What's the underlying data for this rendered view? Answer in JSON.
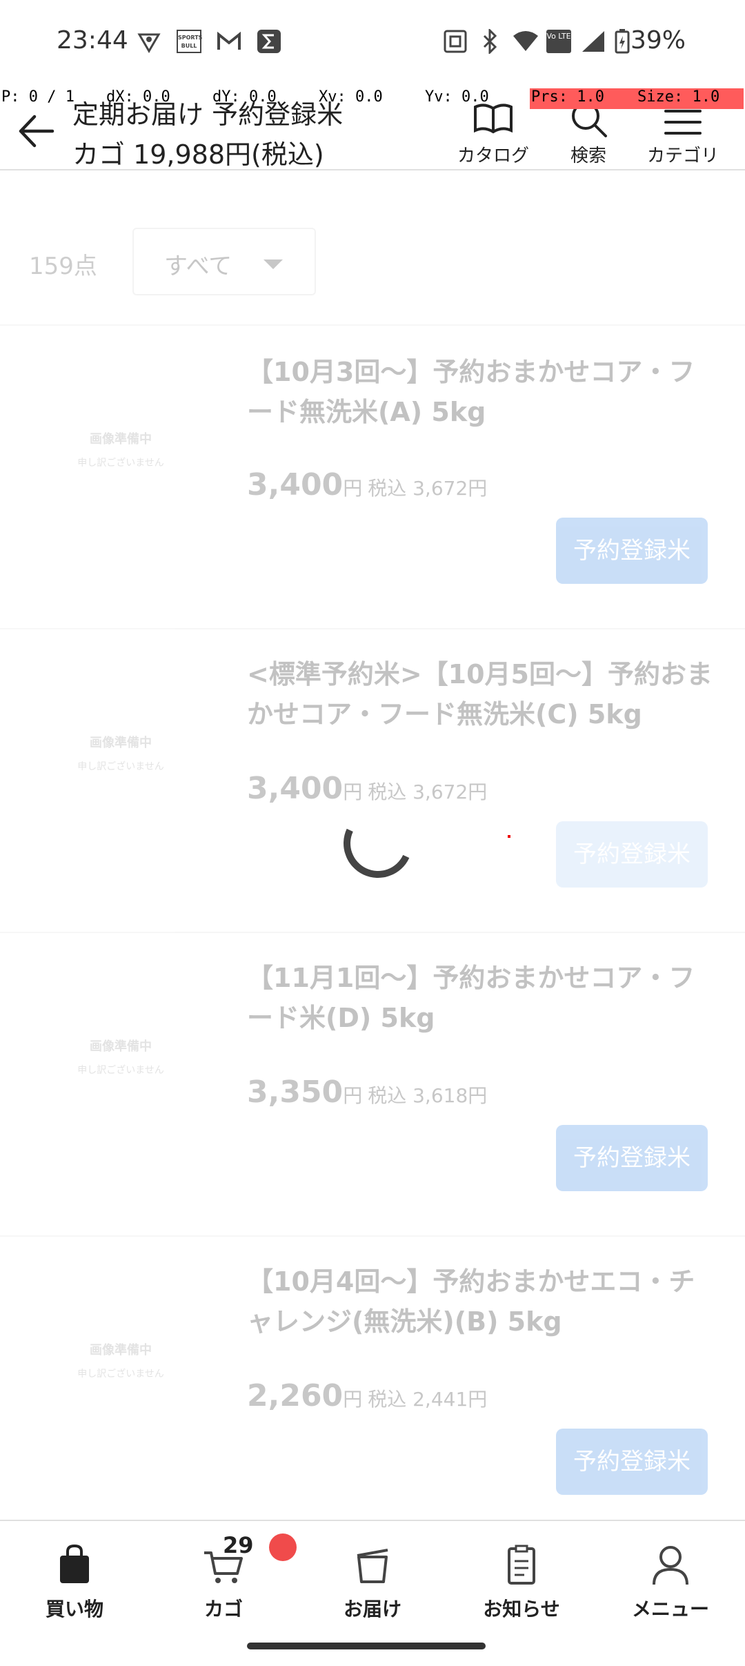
{
  "status_bar": {
    "time": "23:44",
    "battery": "39%",
    "icons": [
      "vpn-icon",
      "sportsbull-icon",
      "gmail-icon",
      "sigma-icon",
      "nfc-icon",
      "bluetooth-icon",
      "wifi-icon",
      "volte-icon",
      "signal-icon",
      "battery-icon"
    ],
    "sportsbull_text": "SPORTS BULL",
    "volte_text": "Vo LTE"
  },
  "debug_overlay": {
    "p": "P: 0 / 1",
    "dx": "dX: 0.0",
    "dy": "dY: 0.0",
    "xv": "Xv: 0.0",
    "yv": "Yv: 0.0",
    "prs": "Prs: 1.0",
    "size": "Size: 1.0"
  },
  "header": {
    "title": "定期お届け 予約登録米",
    "cart_summary": "カゴ 19,988円(税込)",
    "catalog_label": "カタログ",
    "search_label": "検索",
    "category_label": "カテゴリ"
  },
  "list": {
    "count": "159点",
    "filter_value": "すべて"
  },
  "products": [
    {
      "name": "【10月3回〜】予約おまかせコア・フード無洗米(A) 5kg",
      "price": "3,400",
      "yen": "円",
      "tax_price": "税込 3,672円",
      "button": "予約登録米",
      "img_l1": "画像準備中",
      "img_l2": "申し訳ございません"
    },
    {
      "name": "<標準予約米>【10月5回〜】予約おまかせコア・フード無洗米(C) 5kg",
      "price": "3,400",
      "yen": "円",
      "tax_price": "税込 3,672円",
      "button": "予約登録米",
      "img_l1": "画像準備中",
      "img_l2": "申し訳ございません"
    },
    {
      "name": "【11月1回〜】予約おまかせコア・フード米(D) 5kg",
      "price": "3,350",
      "yen": "円",
      "tax_price": "税込 3,618円",
      "button": "予約登録米",
      "img_l1": "画像準備中",
      "img_l2": "申し訳ございません"
    },
    {
      "name": "【10月4回〜】予約おまかせエコ・チャレンジ(無洗米)(B) 5kg",
      "price": "2,260",
      "yen": "円",
      "tax_price": "税込 2,441円",
      "button": "予約登録米",
      "img_l1": "画像準備中",
      "img_l2": "申し訳ございません"
    }
  ],
  "bottom_nav": {
    "shopping": "買い物",
    "cart": "カゴ",
    "cart_count": "29",
    "delivery": "お届け",
    "notices": "お知らせ",
    "menu": "メニュー"
  },
  "colors": {
    "accent_button": "#5a9be8",
    "badge": "#f04b4b",
    "debug_red": "#ff5b5b"
  }
}
